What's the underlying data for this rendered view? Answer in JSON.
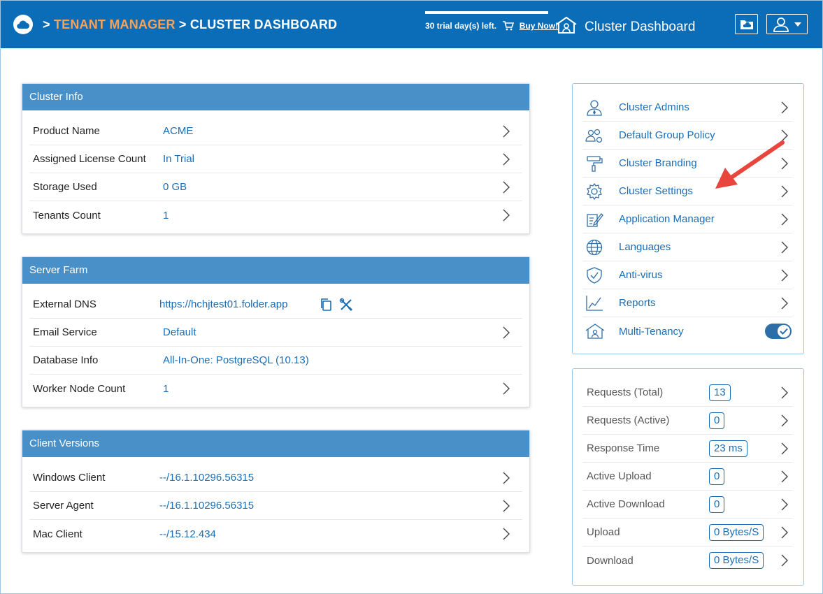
{
  "header": {
    "breadcrumb_sep": ">",
    "crumb_tenant": "TENANT MANAGER",
    "crumb_current": "CLUSTER DASHBOARD",
    "trial_text": "30 trial day(s) left.",
    "buy_now": "Buy Now!",
    "title": "Cluster Dashboard"
  },
  "cluster_info": {
    "title": "Cluster Info",
    "rows": [
      {
        "label": "Product Name",
        "value": "ACME"
      },
      {
        "label": "Assigned License Count",
        "value": "In Trial"
      },
      {
        "label": "Storage Used",
        "value": "0 GB"
      },
      {
        "label": "Tenants Count",
        "value": "1"
      }
    ]
  },
  "server_farm": {
    "title": "Server Farm",
    "rows": [
      {
        "label": "External DNS",
        "value": "https://hchjtest01.folder.app"
      },
      {
        "label": "Email Service",
        "value": "Default"
      },
      {
        "label": "Database Info",
        "value": "All-In-One: PostgreSQL (10.13)"
      },
      {
        "label": "Worker Node Count",
        "value": "1"
      }
    ]
  },
  "client_versions": {
    "title": "Client Versions",
    "rows": [
      {
        "label": "Windows Client",
        "value": "--/16.1.10296.56315"
      },
      {
        "label": "Server Agent",
        "value": "--/16.1.10296.56315"
      },
      {
        "label": "Mac Client",
        "value": "--/15.12.434"
      }
    ]
  },
  "nav": {
    "items": [
      {
        "label": "Cluster Admins",
        "icon": "admin-user-icon"
      },
      {
        "label": "Default Group Policy",
        "icon": "group-policy-icon"
      },
      {
        "label": "Cluster Branding",
        "icon": "paint-roller-icon"
      },
      {
        "label": "Cluster Settings",
        "icon": "gear-icon"
      },
      {
        "label": "Application Manager",
        "icon": "app-manager-icon"
      },
      {
        "label": "Languages",
        "icon": "globe-icon"
      },
      {
        "label": "Anti-virus",
        "icon": "shield-icon"
      },
      {
        "label": "Reports",
        "icon": "chart-icon"
      },
      {
        "label": "Multi-Tenancy",
        "icon": "multi-tenancy-icon"
      }
    ],
    "multi_tenancy_enabled": true
  },
  "stats": {
    "rows": [
      {
        "label": "Requests (Total)",
        "value": "13"
      },
      {
        "label": "Requests (Active)",
        "value": "0"
      },
      {
        "label": "Response Time",
        "value": "23 ms"
      },
      {
        "label": "Active Upload",
        "value": "0"
      },
      {
        "label": "Active Download",
        "value": "0"
      },
      {
        "label": "Upload",
        "value": "0 Bytes/S"
      },
      {
        "label": "Download",
        "value": "0 Bytes/S"
      }
    ]
  },
  "colors": {
    "header_bg": "#0b6cb8",
    "panel_head": "#4a90c8",
    "link_blue": "#1b6db3",
    "crumb_orange": "#f5a25b",
    "annotation_red": "#e8453c"
  }
}
